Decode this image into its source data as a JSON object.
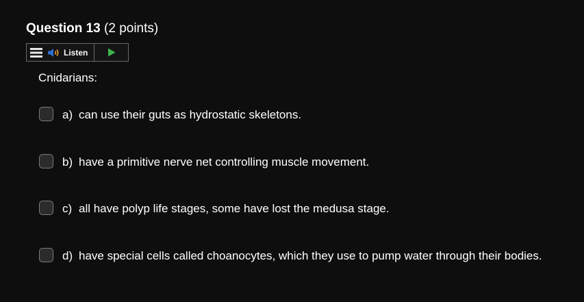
{
  "question": {
    "title": "Question 13",
    "points": "(2 points)"
  },
  "listen": {
    "menu_icon": "hamburger-menu-icon",
    "speaker_icon": "speaker-icon",
    "label": "Listen",
    "play_icon": "play-icon",
    "play_color": "#3cb44b",
    "speaker_color": "#2f6fd6"
  },
  "stem": "Cnidarians:",
  "options": [
    {
      "letter": "a)",
      "text": "can use their guts as hydrostatic skeletons."
    },
    {
      "letter": "b)",
      "text": "have a primitive nerve net controlling muscle movement."
    },
    {
      "letter": "c)",
      "text": "all have polyp life stages, some have lost the medusa stage."
    },
    {
      "letter": "d)",
      "text": "have special cells called choanocytes, which they use to pump water through their bodies."
    }
  ]
}
